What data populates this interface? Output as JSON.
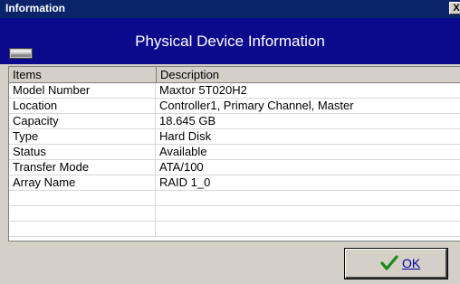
{
  "window": {
    "title": "Information",
    "close_glyph": "X"
  },
  "header": {
    "title": "Physical Device Information",
    "icon": "hard-drive-icon"
  },
  "table": {
    "columns": [
      "Items",
      "Description"
    ],
    "rows": [
      [
        "Model Number",
        "Maxtor 5T020H2"
      ],
      [
        "Location",
        "Controller1, Primary Channel, Master"
      ],
      [
        "Capacity",
        "18.645 GB"
      ],
      [
        "Type",
        "Hard Disk"
      ],
      [
        "Status",
        "Available"
      ],
      [
        "Transfer Mode",
        "ATA/100"
      ],
      [
        "Array Name",
        "RAID 1_0"
      ],
      [
        "",
        ""
      ],
      [
        "",
        ""
      ],
      [
        "",
        ""
      ]
    ]
  },
  "footer": {
    "ok_label": "OK",
    "ok_icon": "checkmark-icon",
    "accent": "#0c0a8c"
  }
}
